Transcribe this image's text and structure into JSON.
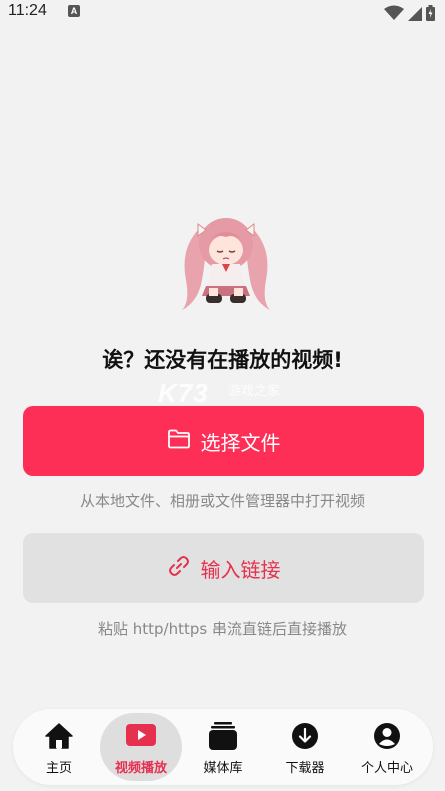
{
  "status_bar": {
    "time": "11:24",
    "notification_badge": "A",
    "icons": [
      "wifi-icon",
      "signal-icon",
      "battery-icon"
    ]
  },
  "empty_state": {
    "illustration": "anime-girl-mascot",
    "title": "诶？还没有在播放的视频!"
  },
  "watermark": {
    "brand": "K73",
    "site": "游戏之家"
  },
  "actions": {
    "choose_file": {
      "label": "选择文件",
      "icon": "folder-icon",
      "hint": "从本地文件、相册或文件管理器中打开视频"
    },
    "enter_link": {
      "label": "输入链接",
      "icon": "link-icon",
      "hint": "粘贴 http/https 串流直链后直接播放"
    }
  },
  "bottom_nav": {
    "items": [
      {
        "label": "主页",
        "icon": "home-icon",
        "active": false
      },
      {
        "label": "视频播放",
        "icon": "play-icon",
        "active": true
      },
      {
        "label": "媒体库",
        "icon": "library-icon",
        "active": false
      },
      {
        "label": "下载器",
        "icon": "download-icon",
        "active": false
      },
      {
        "label": "个人中心",
        "icon": "profile-icon",
        "active": false
      }
    ]
  },
  "colors": {
    "accent": "#fe2f56",
    "accent_text": "#e6304f",
    "background": "#f2f2f2",
    "secondary_button": "#e1e1e1",
    "hint_text": "#888888"
  }
}
